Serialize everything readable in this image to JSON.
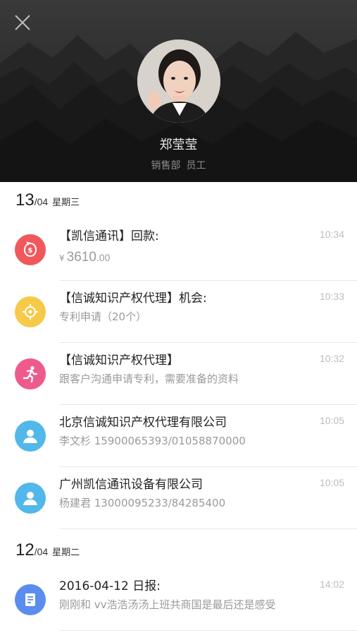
{
  "profile": {
    "name": "郑莹莹",
    "department": "销售部",
    "role": "员工"
  },
  "days": [
    {
      "day": "13",
      "month": "/04",
      "weekday": "星期三",
      "items": [
        {
          "icon": "money-icon",
          "color": "#f0585c",
          "title": "【凯信通讯】回款:",
          "amount": {
            "currency": "¥",
            "main": "3610",
            "cents": ".00"
          },
          "time": "10:34"
        },
        {
          "icon": "target-icon",
          "color": "#f7c948",
          "title": "【信诚知识产权代理】机会:",
          "sub": "专利申请（20个）",
          "time": "10:33"
        },
        {
          "icon": "runner-icon",
          "color": "#ef5a8c",
          "title": "【信诚知识产权代理】",
          "sub": "跟客户沟通申请专利，需要准备的资料",
          "time": "10:32"
        },
        {
          "icon": "contact-icon",
          "color": "#52b7ea",
          "title": "北京信诚知识产权代理有限公司",
          "sub": "李文杉  15900065393/01058870000",
          "time": "10:05"
        },
        {
          "icon": "contact-icon",
          "color": "#52b7ea",
          "title": "广州凯信通讯设备有限公司",
          "sub": "杨建君  13000095233/84285400",
          "time": "10:05"
        }
      ]
    },
    {
      "day": "12",
      "month": "/04",
      "weekday": "星期二",
      "items": [
        {
          "icon": "report-icon",
          "color": "#5b8def",
          "title": "2016-04-12 日报:",
          "sub": "刚刚和 vv浩浩汤汤上班共商国是最后还是感受",
          "time": "14:02"
        }
      ]
    }
  ]
}
